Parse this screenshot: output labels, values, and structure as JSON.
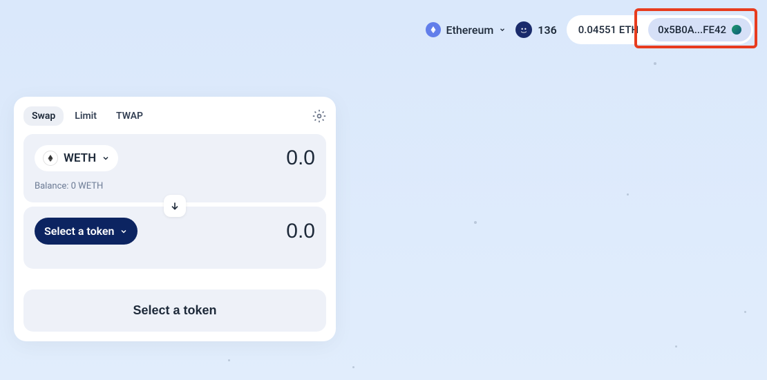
{
  "header": {
    "network": "Ethereum",
    "points": "136",
    "balance": "0.04551 ETH",
    "wallet": "0x5B0A...FE42"
  },
  "swap": {
    "tabs": {
      "swap": "Swap",
      "limit": "Limit",
      "twap": "TWAP"
    },
    "from": {
      "token": "WETH",
      "amount": "0.0",
      "balance": "Balance: 0 WETH"
    },
    "to": {
      "select_label": "Select a token",
      "amount": "0.0"
    },
    "action_button": "Select a token"
  }
}
